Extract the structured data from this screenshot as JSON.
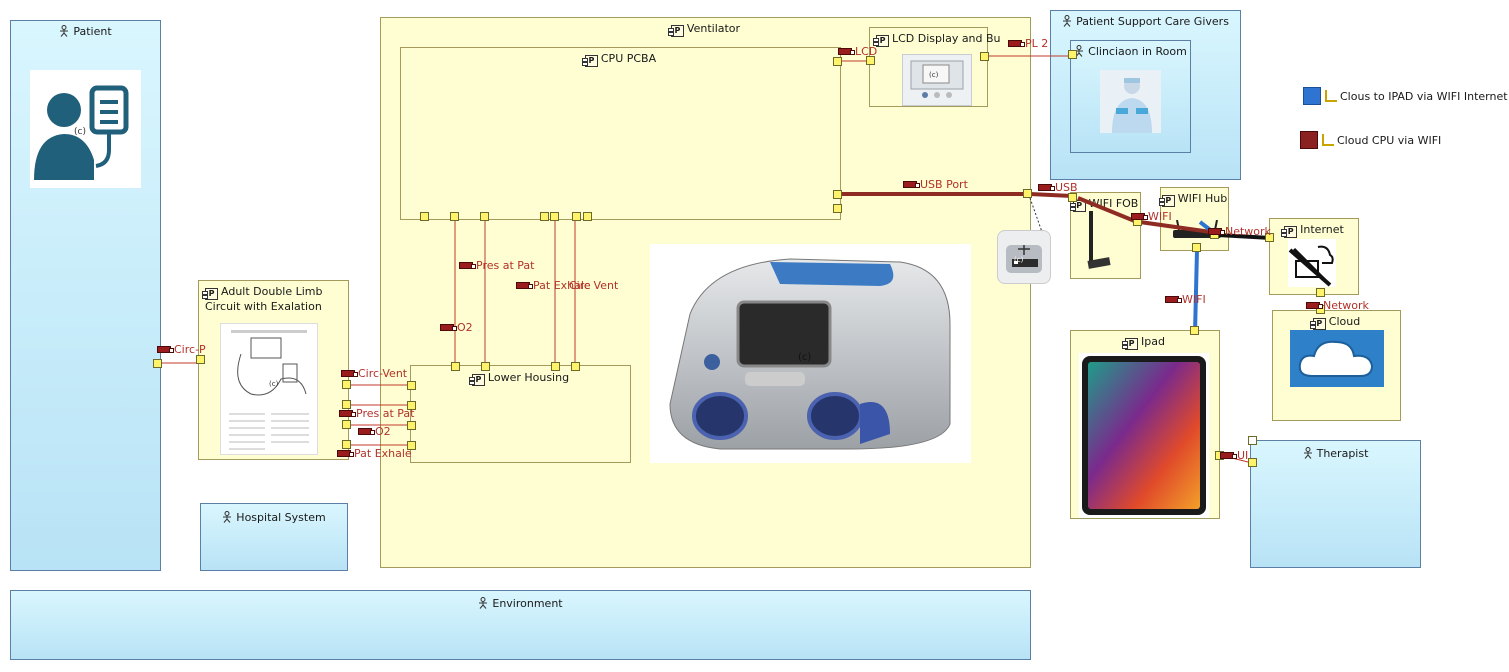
{
  "actors": {
    "patient": "Patient",
    "support": "Patient Support Care Givers",
    "hospital": "Hospital System",
    "therapist": "Therapist",
    "environment": "Environment"
  },
  "parts": {
    "ventilator": "Ventilator",
    "cpu": "CPU PCBA",
    "lcd": "LCD Display and Bu",
    "clinician": "Clinciaon in Room",
    "circuit_line1": "Adult Double Limb",
    "circuit_line2": "Circuit with Exalation",
    "lower_housing": "Lower Housing",
    "wifi_fob": "WIFI FOB",
    "wifi_hub": "WIFI Hub",
    "internet": "Internet",
    "cloud": "Cloud",
    "ipad": "Ipad"
  },
  "stereotype": "P",
  "image_marker": "(c)",
  "ports": {
    "circ_p": "Circ-P",
    "lcd": "LCD",
    "pl2": "PL 2",
    "usb_port": "USB Port",
    "usb": "USB",
    "wifi_fob": "WIFI",
    "network_hub": "Network",
    "network_cloud": "Network",
    "wifi_ipad": "WIFI",
    "ui": "UI",
    "pres_at_pat": "Pres at Pat",
    "pat_exhale": "Pat Exhale",
    "circ_vent_mid": "Circ Vent",
    "o2": "O2",
    "circ_vent": "Circ-Vent",
    "pres_at_pat_l": "Pres at Pat",
    "o2_l": "O2",
    "pat_exhale_l": "Pat Exhale"
  },
  "legend": [
    {
      "label": "Clous to IPAD via WIFI Internet",
      "color": "#2f74d0"
    },
    {
      "label": "Cloud CPU via WIFI",
      "color": "#8b2020"
    }
  ]
}
